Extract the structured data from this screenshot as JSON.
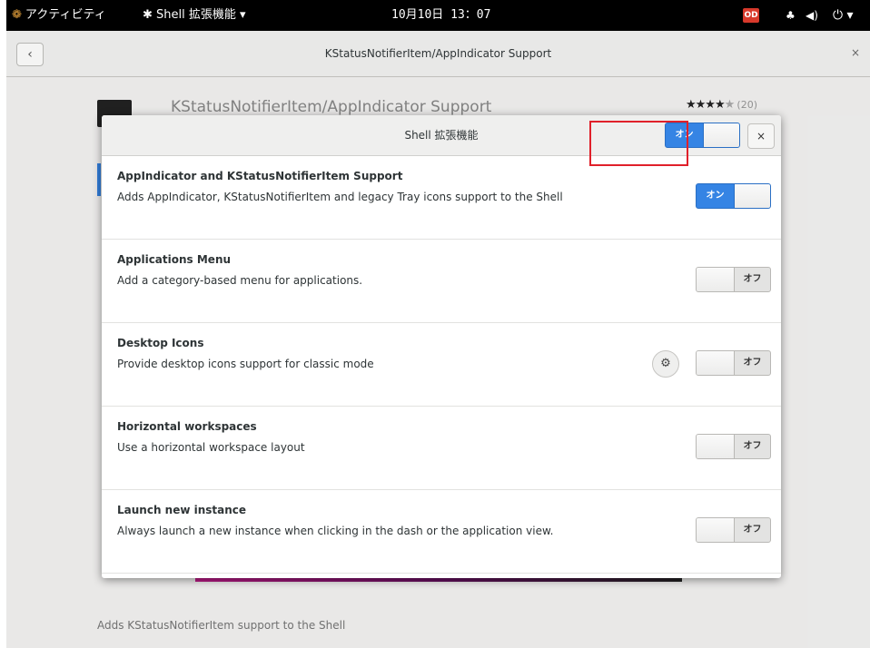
{
  "topbar": {
    "activities": "アクティビティ",
    "extensions_menu": "Shell 拡張機能 ▾",
    "clock": "10月10日 13：07",
    "badge": "OD"
  },
  "window": {
    "title": "KStatusNotifierItem/AppIndicator Support",
    "back_glyph": "‹",
    "close_glyph": "×"
  },
  "background_page": {
    "title": "KStatusNotifierItem/AppIndicator Support",
    "stars_filled": "★★★★",
    "stars_empty": "★",
    "rating_count": "(20)",
    "description": "Adds KStatusNotifierItem support to the Shell"
  },
  "dialog": {
    "title": "Shell 拡張機能",
    "master_switch": {
      "on_label": "オン",
      "state": "on"
    },
    "close_glyph": "×",
    "extensions": [
      {
        "name": "AppIndicator and KStatusNotifierItem Support",
        "description": "Adds AppIndicator, KStatusNotifierItem and legacy Tray icons support to the Shell",
        "state": "on",
        "label": "オン",
        "has_settings": false
      },
      {
        "name": "Applications Menu",
        "description": "Add a category-based menu for applications.",
        "state": "off",
        "label": "オフ",
        "has_settings": false
      },
      {
        "name": "Desktop Icons",
        "description": "Provide desktop icons support for classic mode",
        "state": "off",
        "label": "オフ",
        "has_settings": true
      },
      {
        "name": "Horizontal workspaces",
        "description": "Use a horizontal workspace layout",
        "state": "off",
        "label": "オフ",
        "has_settings": false
      },
      {
        "name": "Launch new instance",
        "description": "Always launch a new instance when clicking in the dash or the application view.",
        "state": "off",
        "label": "オフ",
        "has_settings": false
      }
    ]
  },
  "icons": {
    "activities": "gnome-foot-icon",
    "extensions": "puzzle-icon",
    "network": "network-icon",
    "volume": "volume-icon",
    "power": "power-icon",
    "settings": "gear-icon"
  },
  "colors": {
    "accent": "#3584e4",
    "highlight": "#e0202a"
  }
}
